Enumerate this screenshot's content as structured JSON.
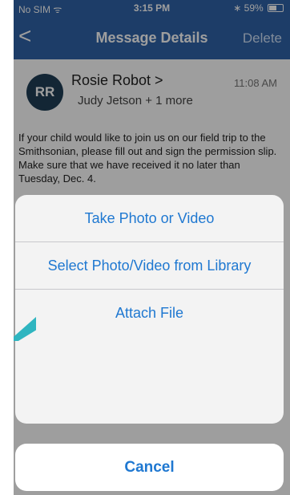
{
  "status_bar": {
    "carrier": "No SIM ᯤ",
    "time": "3:15 PM",
    "battery": "∗ 59%"
  },
  "nav": {
    "back_glyph": "<",
    "title": "Message Details",
    "delete": "Delete"
  },
  "message": {
    "avatar_initials": "RR",
    "sender": "Rosie Robot >",
    "time": "11:08 AM",
    "recipients": "Judy Jetson + 1 more",
    "body": "If your child would like to join us on our field trip to the Smithsonian, please fill out and sign the permission slip. Make sure that we have received it no later than Tuesday, Dec. 4."
  },
  "action_sheet": {
    "items": [
      "Take Photo or Video",
      "Select Photo/Video from Library",
      "Attach File"
    ],
    "cancel": "Cancel"
  },
  "colors": {
    "nav_blue": "#2f63a8",
    "action_blue": "#1f78d1",
    "avatar": "#1f3e56",
    "pointer": "#2fb5c0"
  },
  "icons": {
    "back": "chevron-left-icon",
    "pointer": "arrow-pointer-icon",
    "wifi": "wifi-icon",
    "bluetooth": "bluetooth-icon",
    "battery": "battery-icon"
  }
}
